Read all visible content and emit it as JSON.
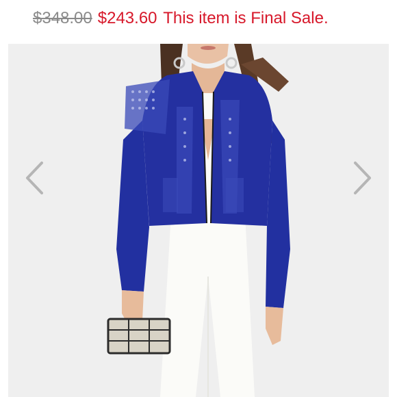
{
  "listing": {
    "original_price": "$348.00",
    "sale_price": "$243.60",
    "sale_note": "This item is Final Sale."
  },
  "carousel": {
    "prev_icon": "chevron-left-icon",
    "next_icon": "chevron-right-icon",
    "arrow_color": "#b5b5b5"
  },
  "colors": {
    "sale_red": "#d7182a",
    "old_price_gray": "#8a8a8a",
    "jacket_blue": "#2430a0"
  }
}
